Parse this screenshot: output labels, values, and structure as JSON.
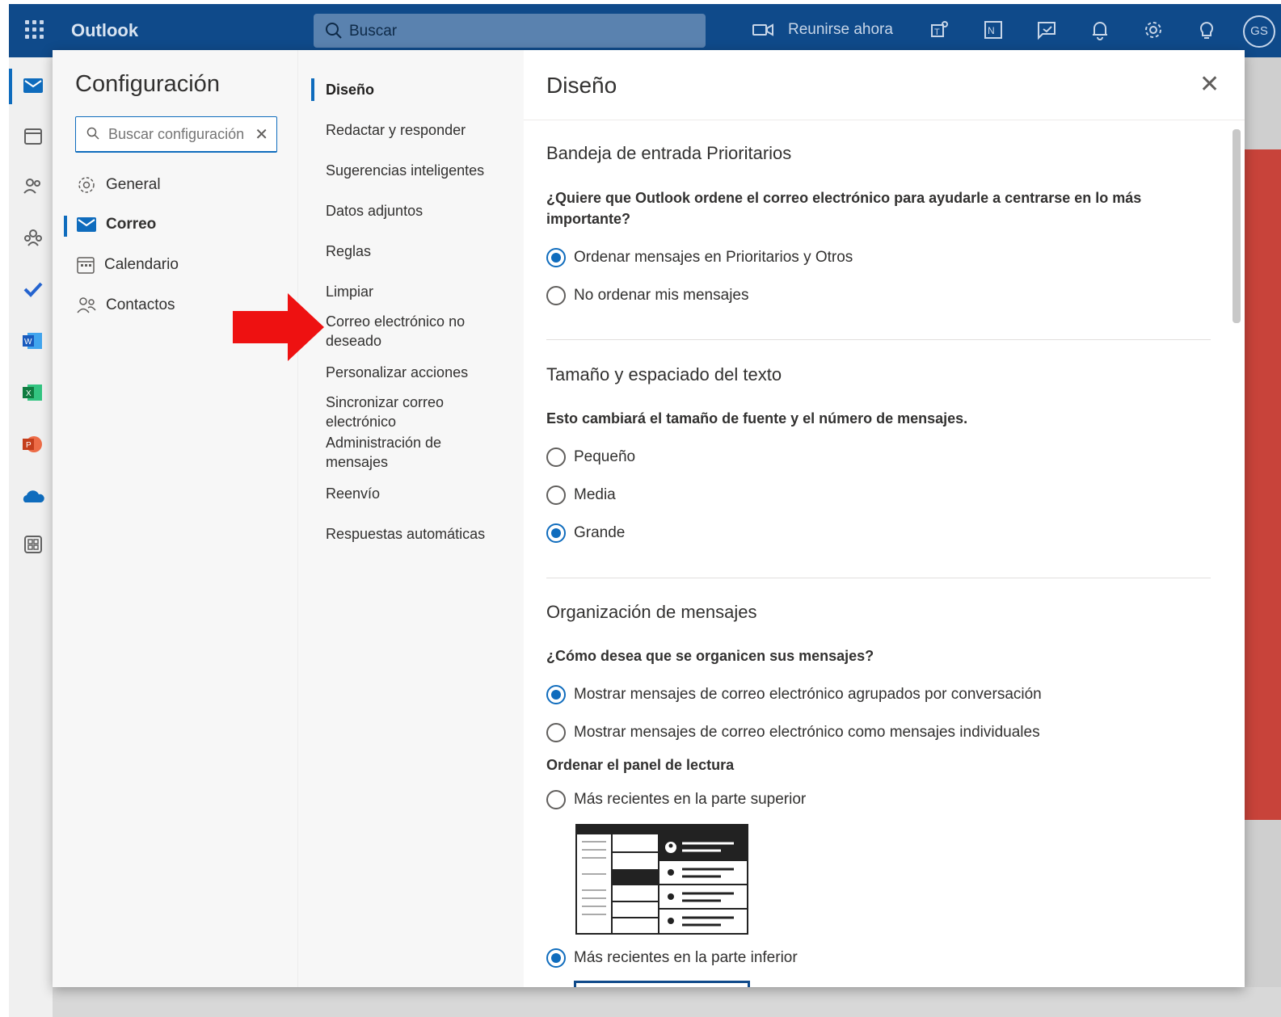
{
  "topbar": {
    "app_name": "Outlook",
    "search_label": "Buscar",
    "meet_now": "Reunirse ahora",
    "avatar_initials": "GS",
    "icons": [
      "waffle-icon",
      "video-icon",
      "teams-icon",
      "onenote-icon",
      "whiteboard-icon",
      "bell-icon",
      "gear-icon",
      "lightbulb-icon"
    ]
  },
  "rail": {
    "items": [
      "mail-icon",
      "calendar-icon",
      "people-icon",
      "groups-icon",
      "todo-icon",
      "word-icon",
      "excel-icon",
      "powerpoint-icon",
      "onedrive-icon",
      "apps-icon"
    ]
  },
  "settings": {
    "title": "Configuración",
    "search_placeholder": "Buscar configuración",
    "search_value": "",
    "categories": [
      {
        "label": "General",
        "icon": "gear-icon"
      },
      {
        "label": "Correo",
        "icon": "mail-icon"
      },
      {
        "label": "Calendario",
        "icon": "calendar-icon"
      },
      {
        "label": "Contactos",
        "icon": "people-icon"
      }
    ],
    "subcategories": [
      "Diseño",
      "Redactar y responder",
      "Sugerencias inteligentes",
      "Datos adjuntos",
      "Reglas",
      "Limpiar",
      "Correo electrónico no deseado",
      "Personalizar acciones",
      "Sincronizar correo electrónico",
      "Administración de mensajes",
      "Reenvío",
      "Respuestas automáticas"
    ]
  },
  "pane": {
    "title": "Diseño",
    "focused": {
      "heading": "Bandeja de entrada Prioritarios",
      "question": "¿Quiere que Outlook ordene el correo electrónico para ayudarle a centrarse en lo más importante?",
      "options": [
        "Ordenar mensajes en Prioritarios y Otros",
        "No ordenar mis mensajes"
      ],
      "selected": 0
    },
    "text_size": {
      "heading": "Tamaño y espaciado del texto",
      "question": "Esto cambiará el tamaño de fuente y el número de mensajes.",
      "options": [
        "Pequeño",
        "Media",
        "Grande"
      ],
      "selected": 2
    },
    "organization": {
      "heading": "Organización de mensajes",
      "question": "¿Cómo desea que se organicen sus mensajes?",
      "options": [
        "Mostrar mensajes de correo electrónico agrupados por conversación",
        "Mostrar mensajes de correo electrónico como mensajes individuales"
      ],
      "selected": 0,
      "reading_heading": "Ordenar el panel de lectura",
      "reading_options": [
        "Más recientes en la parte superior",
        "Más recientes en la parte inferior"
      ],
      "reading_selected": 1
    }
  },
  "colors": {
    "accent": "#0f6cbd",
    "topbar": "#0f4a8a",
    "annotation_arrow": "#ee1111"
  }
}
